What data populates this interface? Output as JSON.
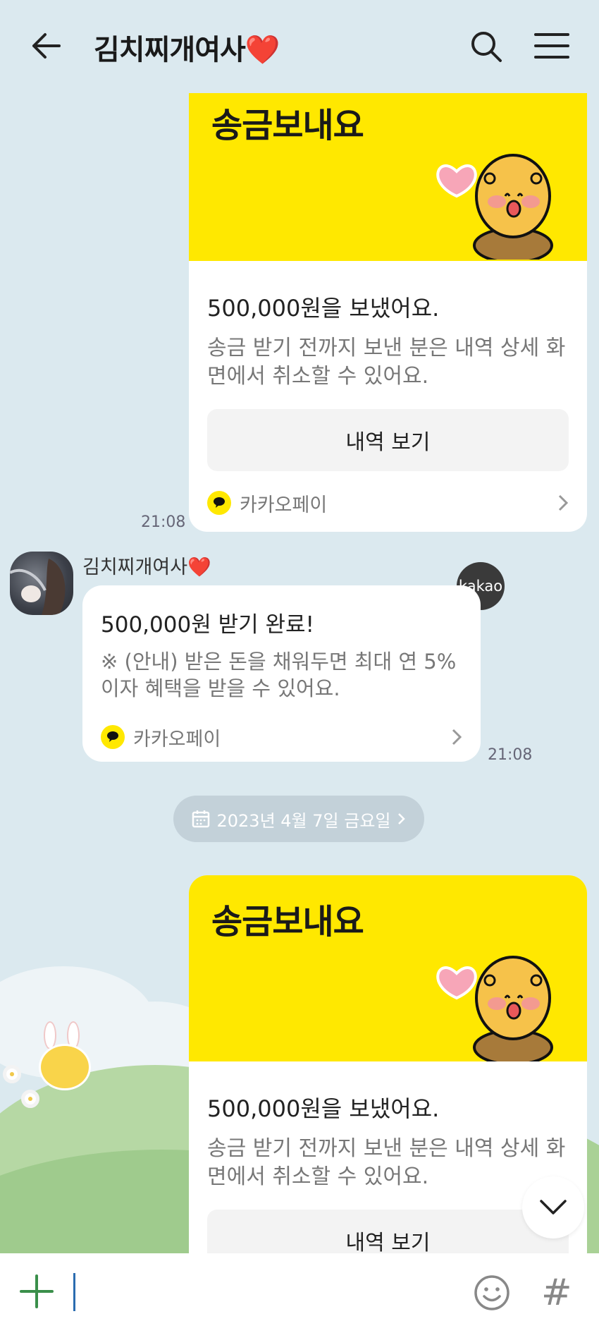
{
  "header": {
    "title": "김치찌개여사❤️"
  },
  "messages": {
    "sent_1": {
      "banner_title": "송금보내요",
      "amount_text": "500,000원을 보냈어요.",
      "description": "송금 받기 전까지 보낸 분은 내역 상세 화면에서 취소할 수 있어요.",
      "button_label": "내역 보기",
      "brand": "카카오페이",
      "time": "21:08"
    },
    "received_1": {
      "sender": "김치찌개여사❤️",
      "title": "500,000원 받기 완료!",
      "description": "※ (안내) 받은 돈을 채워두면 최대 연 5% 이자 혜택을 받을 수 있어요.",
      "brand": "카카오페이",
      "badge": "kakao",
      "time": "21:08"
    },
    "date_divider": "2023년 4월 7일 금요일",
    "sent_2": {
      "banner_title": "송금보내요",
      "amount_text": "500,000원을 보냈어요.",
      "description": "송금 받기 전까지 보낸 분은 내역 상세 화면에서 취소할 수 있어요.",
      "button_label": "내역 보기"
    }
  },
  "input": {
    "placeholder": ""
  },
  "colors": {
    "background": "#dbe9ef",
    "kakao_yellow": "#ffe800"
  },
  "icons": [
    "back-arrow-icon",
    "search-icon",
    "menu-icon",
    "chevron-right-icon",
    "calendar-icon",
    "chevron-down-icon",
    "plus-icon",
    "emoji-icon",
    "hashtag-icon"
  ]
}
